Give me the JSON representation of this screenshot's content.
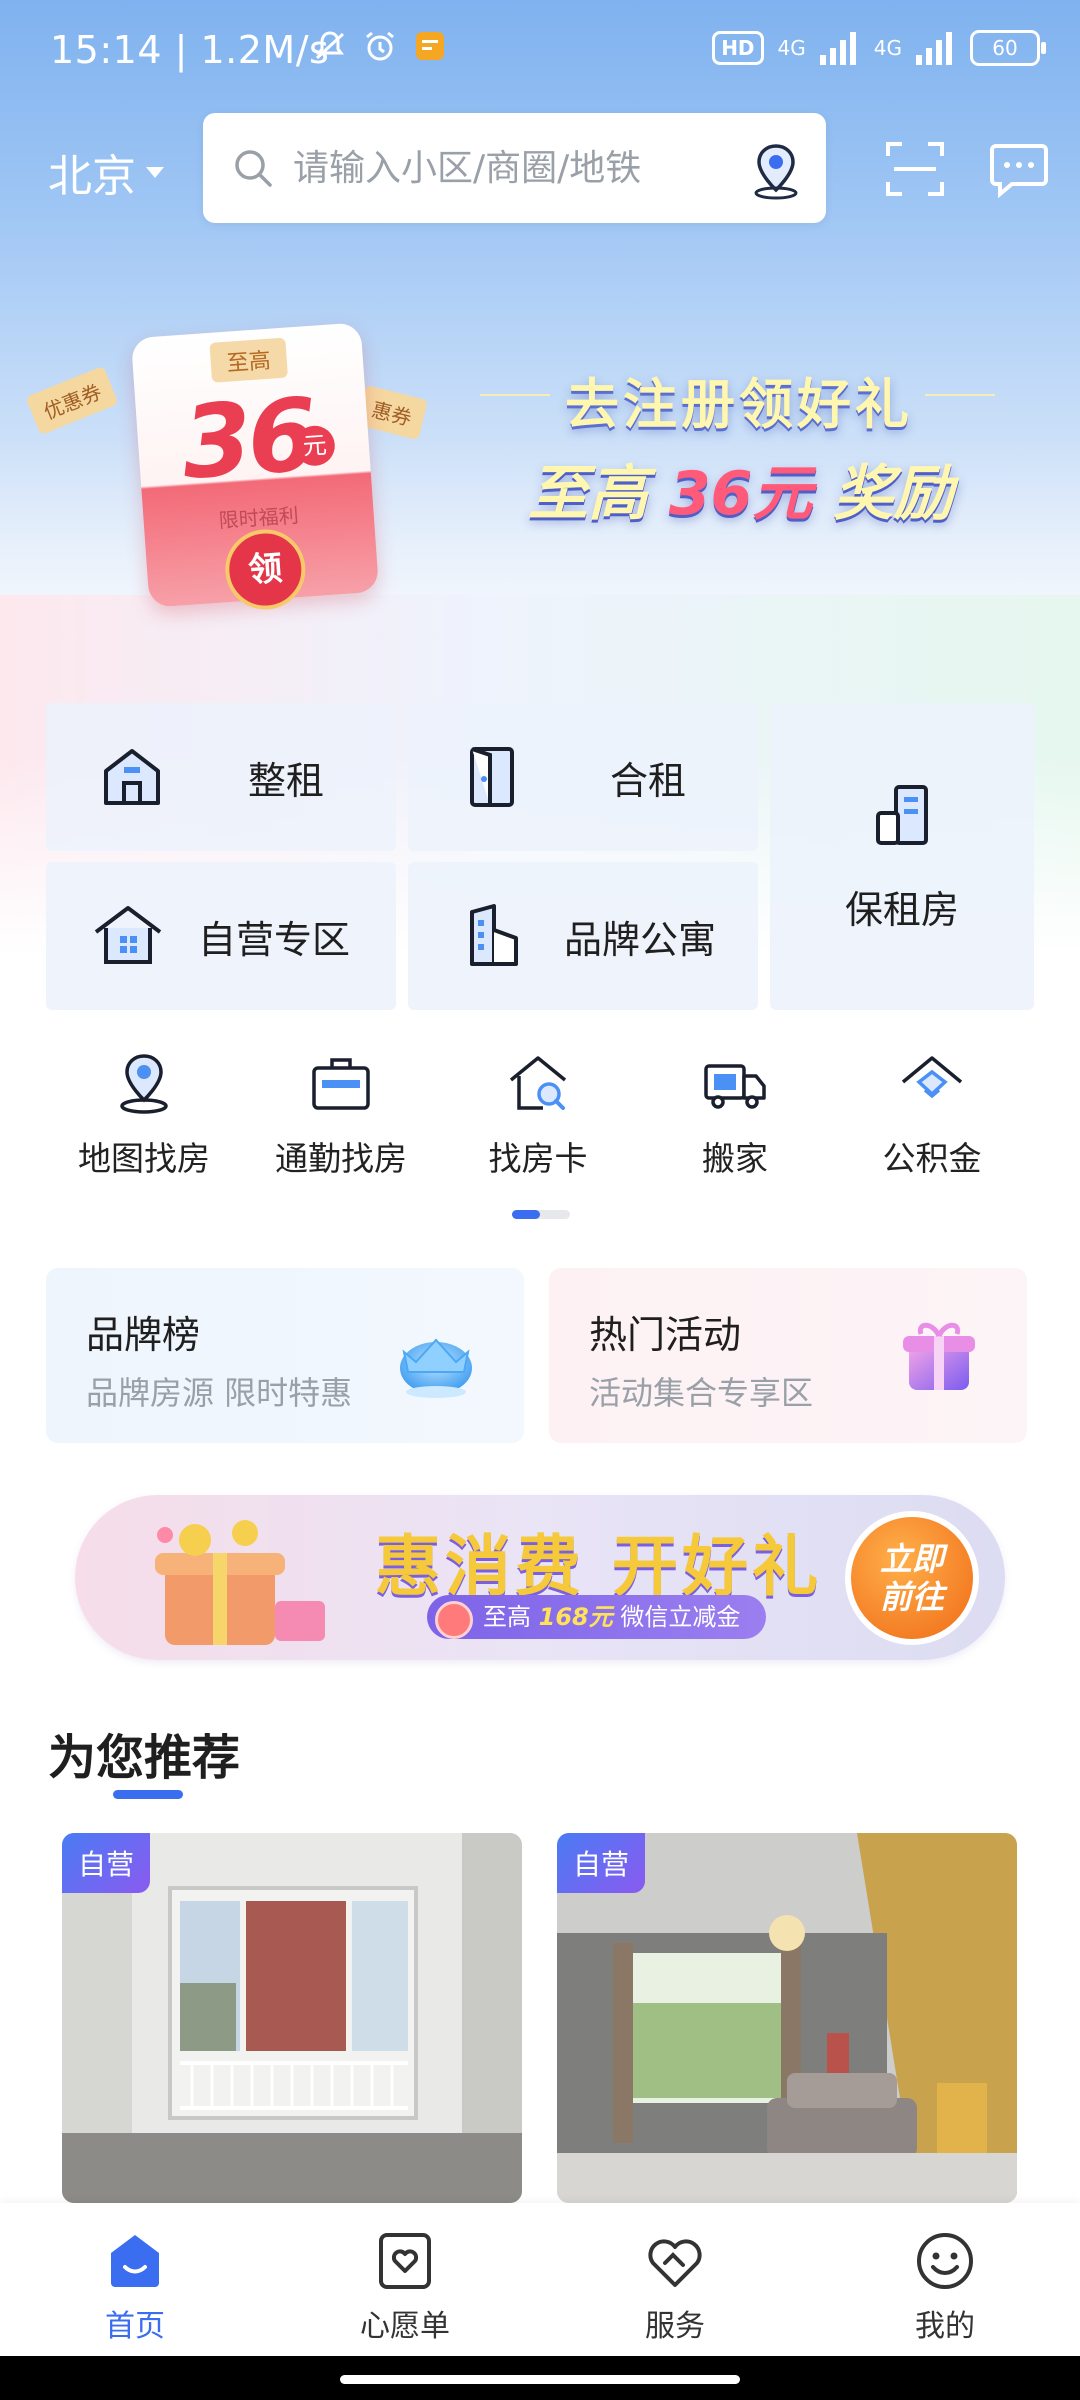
{
  "status_bar": {
    "time": "15:14 | 1.2M/s",
    "hd": "HD",
    "network_1": "4G",
    "network_2": "4G",
    "battery": "60"
  },
  "header": {
    "city": "北京",
    "search_placeholder": "请输入小区/商圈/地铁"
  },
  "banner": {
    "coupon_top": "至高",
    "coupon_amount": "36",
    "coupon_unit": "元",
    "coupon_sub": "限时福利",
    "coupon_button": "领",
    "tag_left": "优惠券",
    "tag_right": "惠券",
    "title": "去注册领好礼",
    "sub_prefix": "至高",
    "sub_highlight": "36元",
    "sub_suffix": "奖励"
  },
  "grid": {
    "whole_rent": "整租",
    "shared_rent": "合租",
    "self_operated": "自营专区",
    "brand_apartment": "品牌公寓",
    "affordable_rental": "保租房"
  },
  "shortcuts": [
    {
      "label": "地图找房",
      "icon": "map-pin-icon"
    },
    {
      "label": "通勤找房",
      "icon": "briefcase-icon"
    },
    {
      "label": "找房卡",
      "icon": "house-search-icon"
    },
    {
      "label": "搬家",
      "icon": "truck-icon"
    },
    {
      "label": "公积金",
      "icon": "fund-icon"
    }
  ],
  "cards": {
    "brand_list_title": "品牌榜",
    "brand_list_sub": "品牌房源 限时特惠",
    "hot_events_title": "热门活动",
    "hot_events_sub": "活动集合专享区"
  },
  "promo": {
    "title": "惠消费 开好礼",
    "sub_prefix": "至高",
    "sub_highlight": "168元",
    "sub_suffix": "微信立减金",
    "button_line1": "立即",
    "button_line2": "前往"
  },
  "recommend": {
    "title": "为您推荐",
    "listings": [
      {
        "badge": "自营"
      },
      {
        "badge": "自营"
      }
    ]
  },
  "bottom_nav": [
    {
      "label": "首页",
      "icon": "home-icon",
      "active": true
    },
    {
      "label": "心愿单",
      "icon": "wishlist-icon",
      "active": false
    },
    {
      "label": "服务",
      "icon": "service-icon",
      "active": false
    },
    {
      "label": "我的",
      "icon": "profile-icon",
      "active": false
    }
  ],
  "colors": {
    "accent": "#3a6df0",
    "sky_top": "#7fb2ef",
    "promo_button": "#f06a16",
    "coupon_red": "#ea3f52"
  }
}
